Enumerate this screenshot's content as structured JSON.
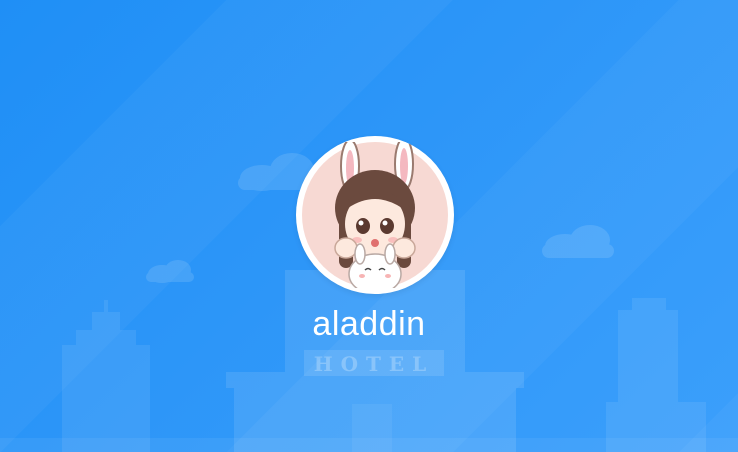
{
  "profile": {
    "username": "aladdin",
    "avatar_icon": "bunny-girl-avatar-icon"
  },
  "background": {
    "sign_text": "HOTEL"
  },
  "colors": {
    "background_start": "#1f8ff6",
    "background_end": "#3b9ffb",
    "username": "#ffffff"
  }
}
